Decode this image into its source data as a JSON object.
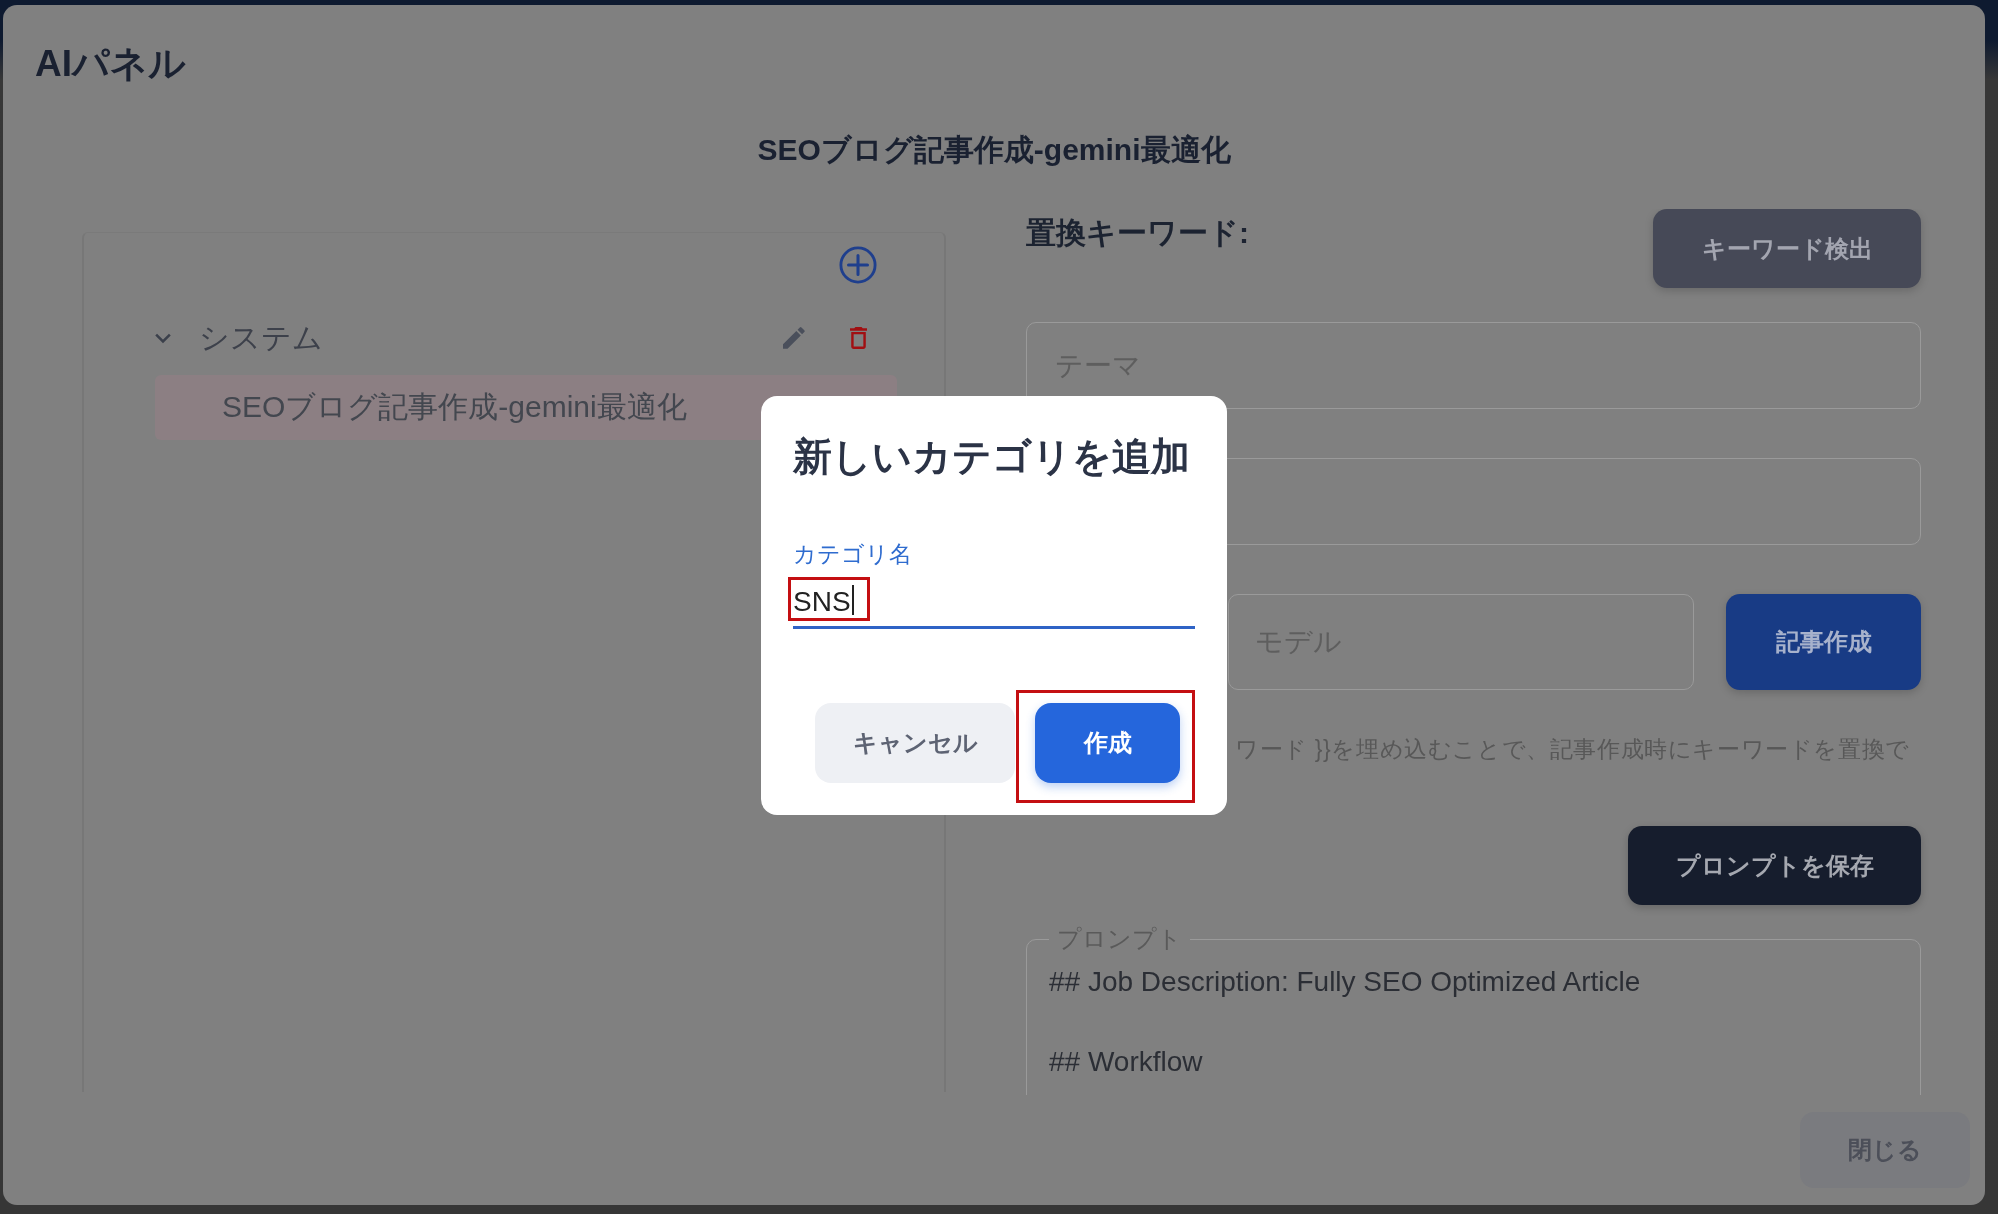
{
  "panel": {
    "title": "AIパネル",
    "subtitle": "SEOブログ記事作成-gemini最適化",
    "close_button": "閉じる"
  },
  "category_tree": {
    "items": [
      {
        "label": "システム",
        "expanded": true,
        "children": [
          {
            "label": "SEOブログ記事作成-gemini最適化",
            "selected": true
          }
        ]
      }
    ]
  },
  "editor": {
    "keyword_heading": "置換キーワード:",
    "detect_button": "キーワード検出",
    "fields": [
      {
        "kind": "text",
        "placeholder": "テーマ"
      },
      {
        "kind": "text"
      }
    ],
    "model_select": {
      "placeholder": "モデル"
    },
    "create_article_button": "記事作成",
    "hint": "ワード }}を埋め込むことで、記事作成時にキーワードを置換で",
    "save_button": "プロンプトを保存",
    "prompt": {
      "label": "プロンプト",
      "value": "## Job Description: Fully SEO Optimized Article\n\n## Workflow"
    }
  },
  "dialog": {
    "title": "新しいカテゴリを追加",
    "field": {
      "label": "カテゴリ名",
      "value": "SNS",
      "focused": true,
      "highlighted": true
    },
    "buttons": [
      {
        "kind": "secondary",
        "label": "キャンセル",
        "highlighted": false
      },
      {
        "kind": "primary",
        "label": "作成",
        "highlighted": true
      }
    ]
  }
}
